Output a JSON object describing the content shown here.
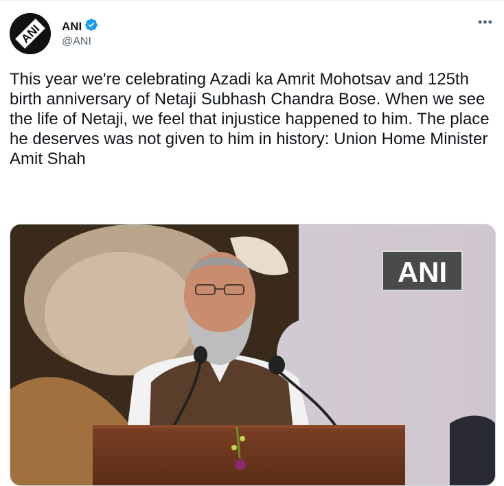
{
  "tweet": {
    "author_name": "ANI",
    "author_handle": "@ANI",
    "verified": true,
    "more_icon": "ellipsis-icon",
    "text": "This year we're celebrating Azadi ka Amrit Mohotsav and 125th birth anniversary of Netaji Subhash Chandra Bose. When we see the life of Netaji, we feel that injustice happened to him. The place he deserves was not given to him in history: Union Home Minister Amit Shah",
    "avatar_logo_text": "ANI",
    "media": {
      "watermark_text": "ANI"
    }
  },
  "colors": {
    "text_primary": "#0f1419",
    "text_secondary": "#536471",
    "verified_blue": "#1d9bf0",
    "border": "#cfd9de"
  },
  "icons": {
    "verified": "verified-badge-icon",
    "more": "ellipsis-icon"
  }
}
